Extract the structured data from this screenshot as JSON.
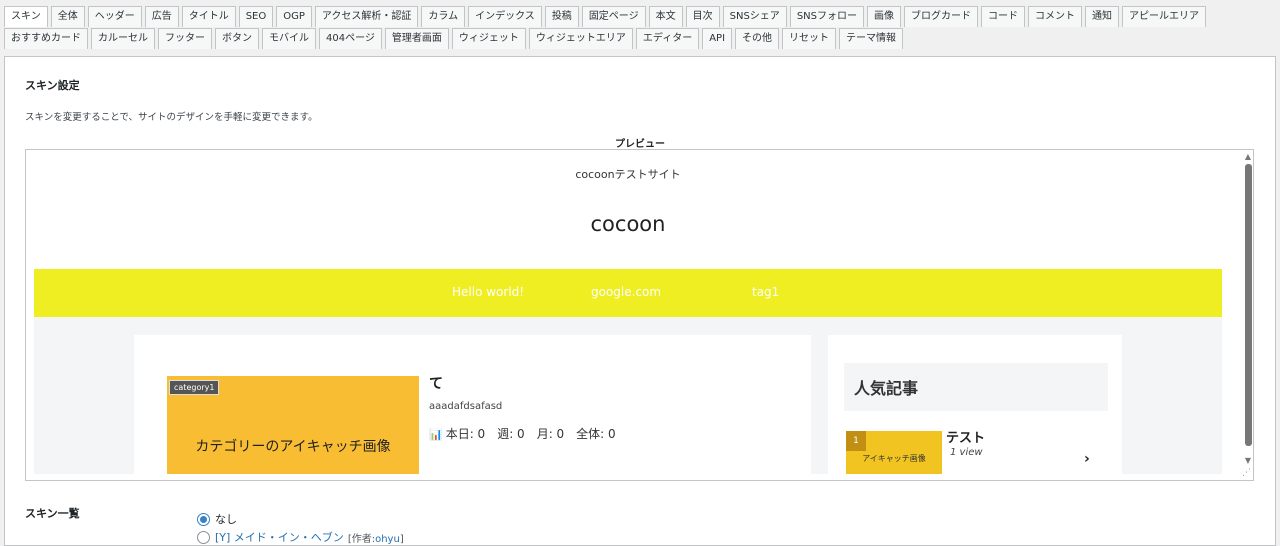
{
  "tabs_row1": [
    "スキン",
    "全体",
    "ヘッダー",
    "広告",
    "タイトル",
    "SEO",
    "OGP",
    "アクセス解析・認証",
    "カラム",
    "インデックス",
    "投稿",
    "固定ページ",
    "本文",
    "目次",
    "SNSシェア",
    "SNSフォロー",
    "画像",
    "ブログカード",
    "コード",
    "コメント",
    "通知",
    "アピールエリア"
  ],
  "tabs_row2": [
    "おすすめカード",
    "カルーセル",
    "フッター",
    "ボタン",
    "モバイル",
    "404ページ",
    "管理者画面",
    "ウィジェット",
    "ウィジェットエリア",
    "エディター",
    "API",
    "その他",
    "リセット",
    "テーマ情報"
  ],
  "section": {
    "title": "スキン設定",
    "description": "スキンを変更することで、サイトのデザインを手軽に変更できます。",
    "preview_label": "プレビュー"
  },
  "preview": {
    "tagline": "cocoonテストサイト",
    "site_title": "cocoon",
    "nav": [
      "Hello world!",
      "google.com",
      "tag1"
    ],
    "accent_color": "#eeee22",
    "post": {
      "category": "category1",
      "eyecatch_text": "カテゴリーのアイキャッチ画像",
      "title": "て",
      "excerpt": "aaadafdsafasd",
      "stats": "本日: 0　週: 0　月: 0　全体: 0"
    },
    "popular": {
      "heading": "人気記事",
      "rank": "1",
      "thumb_text": "アイキャッチ画像",
      "title": "テスト",
      "views": "1 view"
    }
  },
  "skin_list": {
    "title": "スキン一覧",
    "options": [
      {
        "label": "なし",
        "checked": true
      },
      {
        "label": "[Y] メイド・イン・ヘブン",
        "author_prefix": "[作者:",
        "author": "ohyu",
        "author_suffix": "]",
        "checked": false
      }
    ]
  }
}
